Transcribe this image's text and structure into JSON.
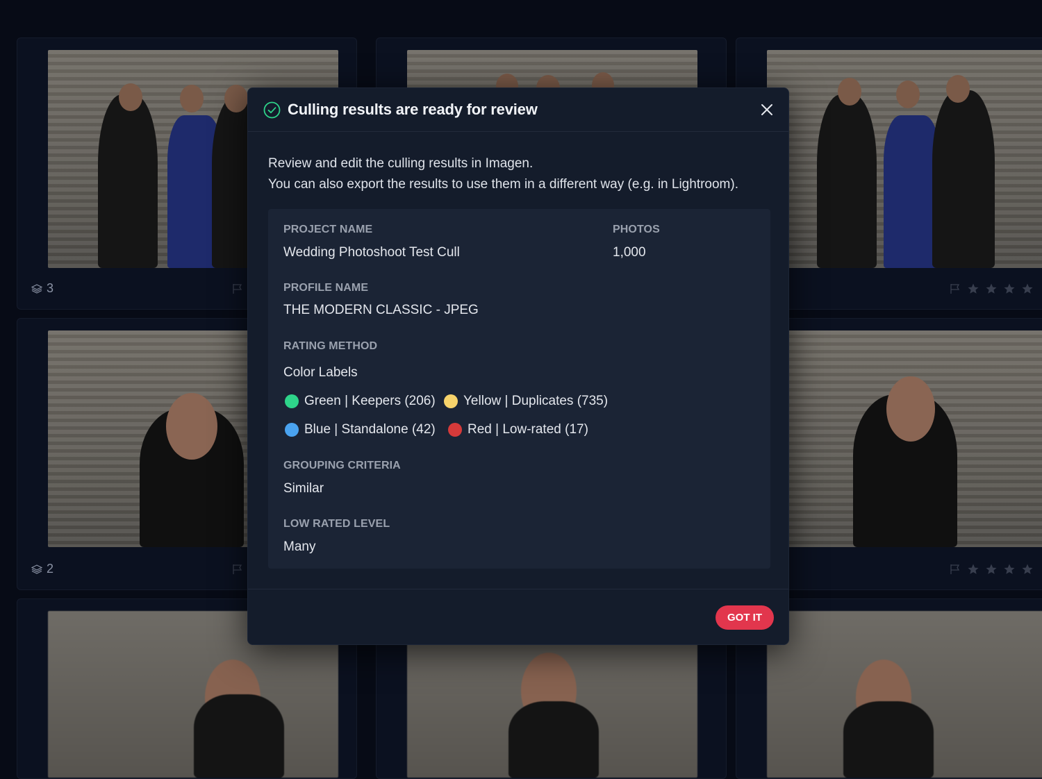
{
  "grid": {
    "cards": [
      {
        "stack_count": "3",
        "rating_stars": 0
      },
      {
        "stack_count": "",
        "rating_stars": 0
      },
      {
        "stack_count": "",
        "rating_stars": 0
      },
      {
        "stack_count": "2",
        "rating_stars": 0
      },
      {
        "stack_count": "",
        "rating_stars": 0
      },
      {
        "stack_count": "",
        "rating_stars": 0
      }
    ]
  },
  "dialog": {
    "title": "Culling results are ready for review",
    "status_icon": "check-circle-icon",
    "close_icon": "close-icon",
    "intro_line1": "Review and edit the culling results in Imagen.",
    "intro_line2": "You can also export the results to use them in a different way (e.g. in Lightroom).",
    "project_name_label": "PROJECT NAME",
    "project_name": "Wedding Photoshoot Test Cull",
    "photos_label": "PHOTOS",
    "photos": "1,000",
    "profile_name_label": "PROFILE NAME",
    "profile_name": "THE MODERN CLASSIC - JPEG",
    "rating_method_label": "RATING METHOD",
    "rating_method": "Color Labels",
    "color_labels": [
      {
        "text": "Green | Keepers (206)",
        "color": "#2ed48a"
      },
      {
        "text": "Yellow | Duplicates (735)",
        "color": "#f7d36b"
      },
      {
        "text": "Blue | Standalone (42)",
        "color": "#4aa3f0"
      },
      {
        "text": "Red | Low-rated (17)",
        "color": "#d63a3a"
      }
    ],
    "grouping_criteria_label": "GROUPING CRITERIA",
    "grouping_criteria": "Similar",
    "low_rated_level_label": "LOW RATED LEVEL",
    "low_rated_level": "Many",
    "confirm_label": "GOT IT"
  },
  "colors": {
    "accent": "#e2364d",
    "success": "#2ed48a",
    "panel_bg": "#1b2435",
    "modal_bg": "#141c2b"
  }
}
